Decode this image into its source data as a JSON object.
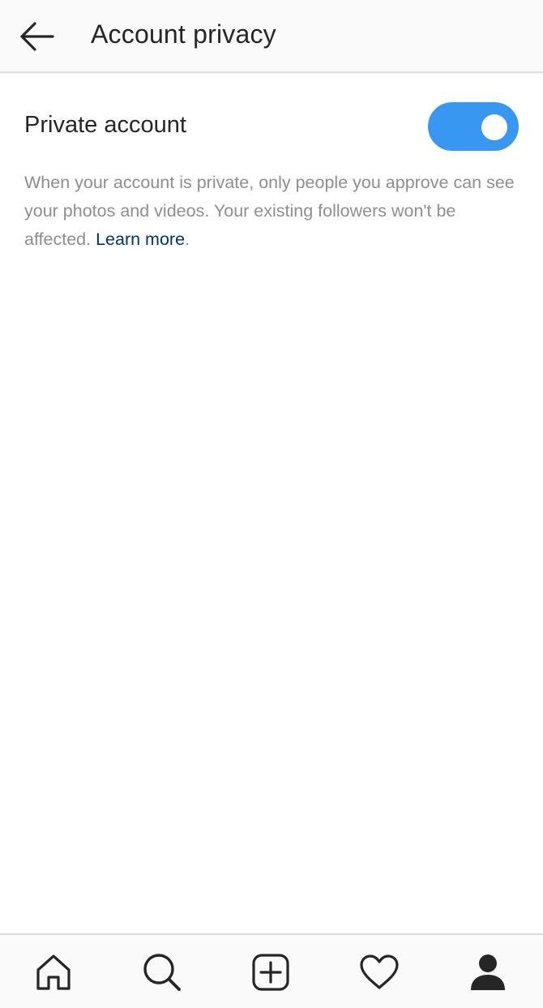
{
  "header": {
    "back_icon": "arrow-left-icon",
    "title": "Account privacy"
  },
  "privacy": {
    "label": "Private account",
    "enabled": true,
    "toggle_color": "#3897f0",
    "description": "When your account is private, only people you approve can see your photos and videos. Your existing followers won't be affected.",
    "learn_more": "Learn more",
    "trailing_period": "."
  },
  "bottom_nav": {
    "items": [
      {
        "icon": "home-icon",
        "active": false
      },
      {
        "icon": "search-icon",
        "active": false
      },
      {
        "icon": "new-post-icon",
        "active": false
      },
      {
        "icon": "heart-icon",
        "active": false
      },
      {
        "icon": "profile-icon",
        "active": true
      }
    ]
  }
}
